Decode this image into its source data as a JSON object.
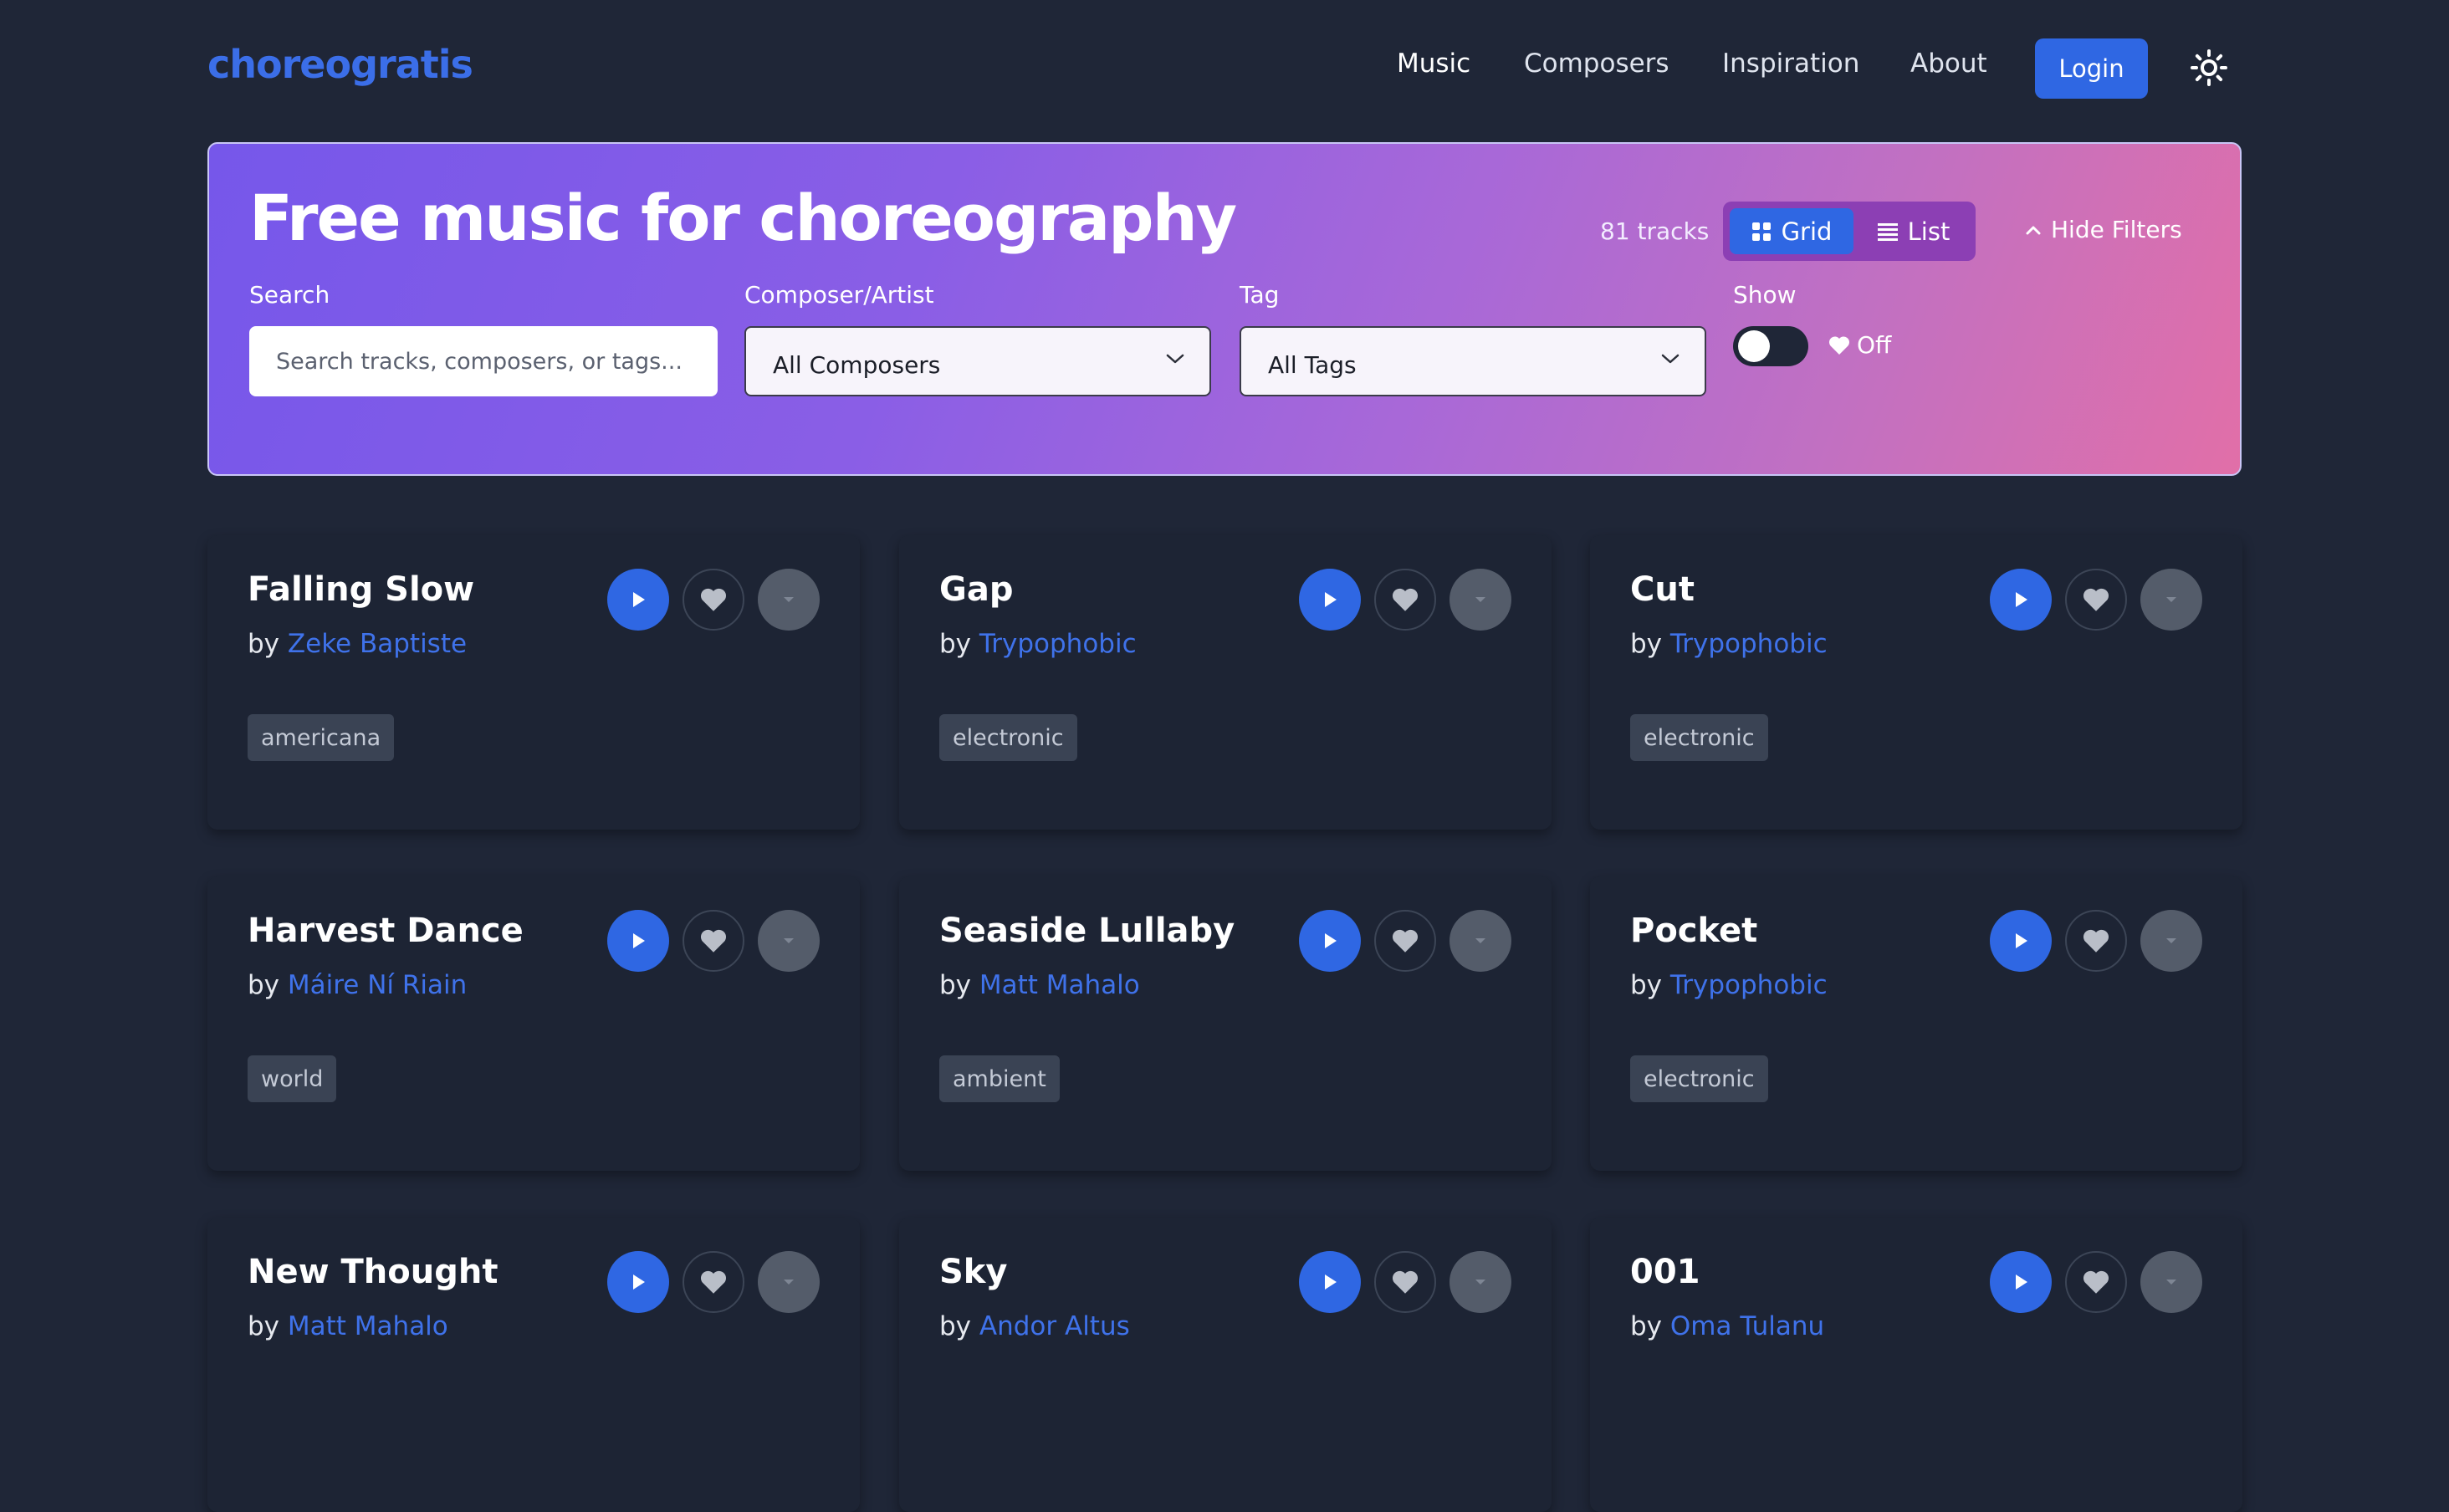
{
  "brand": {
    "logo": "choreogratis"
  },
  "nav": {
    "items": [
      "Music",
      "Composers",
      "Inspiration",
      "About"
    ],
    "login_label": "Login"
  },
  "hero": {
    "title": "Free music for choreography",
    "track_count": "81 tracks",
    "view_grid_label": "Grid",
    "view_list_label": "List",
    "hide_filters_label": "Hide Filters",
    "filters": {
      "search_label": "Search",
      "search_placeholder": "Search tracks, composers, or tags...",
      "composer_label": "Composer/Artist",
      "composer_value": "All Composers",
      "tag_label": "Tag",
      "tag_value": "All Tags",
      "show_label": "Show",
      "favorites_toggle": "Off"
    }
  },
  "tracks": [
    {
      "title": "Falling Slow",
      "by": "by",
      "composer": "Zeke Baptiste",
      "tag": "americana"
    },
    {
      "title": "Gap",
      "by": "by",
      "composer": "Trypophobic",
      "tag": "electronic"
    },
    {
      "title": "Cut",
      "by": "by",
      "composer": "Trypophobic",
      "tag": "electronic"
    },
    {
      "title": "Harvest Dance",
      "by": "by",
      "composer": "Máire Ní Riain",
      "tag": "world"
    },
    {
      "title": "Seaside Lullaby",
      "by": "by",
      "composer": "Matt Mahalo",
      "tag": "ambient"
    },
    {
      "title": "Pocket",
      "by": "by",
      "composer": "Trypophobic",
      "tag": "electronic"
    },
    {
      "title": "New Thought",
      "by": "by",
      "composer": "Matt Mahalo",
      "tag": ""
    },
    {
      "title": "Sky",
      "by": "by",
      "composer": "Andor Altus",
      "tag": ""
    },
    {
      "title": "001",
      "by": "by",
      "composer": "Oma Tulanu",
      "tag": ""
    }
  ],
  "colors": {
    "background": "#1f2637",
    "accent": "#2f67e3",
    "link": "#3f72ea",
    "card": "#1d2434"
  }
}
